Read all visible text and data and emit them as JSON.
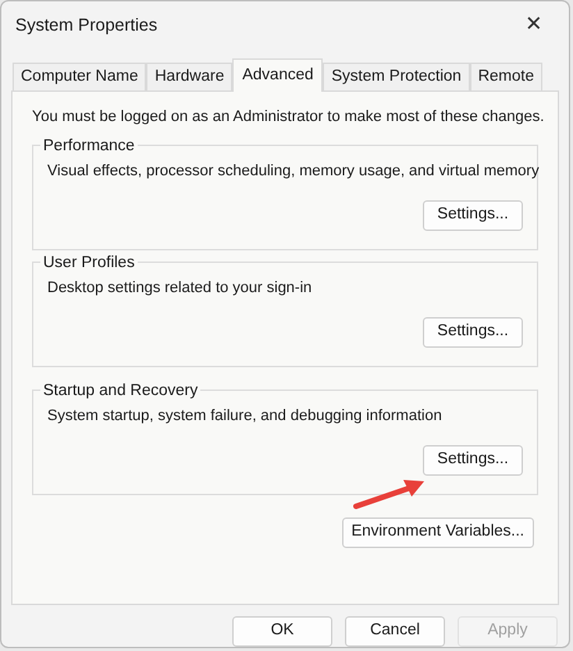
{
  "window": {
    "title": "System Properties",
    "close": "✕"
  },
  "tabs": [
    {
      "label": "Computer Name",
      "selected": false
    },
    {
      "label": "Hardware",
      "selected": false
    },
    {
      "label": "Advanced",
      "selected": true
    },
    {
      "label": "System Protection",
      "selected": false
    },
    {
      "label": "Remote",
      "selected": false
    }
  ],
  "notice": "You must be logged on as an Administrator to make most of these changes.",
  "groups": [
    {
      "title": "Performance",
      "description": "Visual effects, processor scheduling, memory usage, and virtual memory",
      "button": "Settings..."
    },
    {
      "title": "User Profiles",
      "description": "Desktop settings related to your sign-in",
      "button": "Settings..."
    },
    {
      "title": "Startup and Recovery",
      "description": "System startup, system failure, and debugging information",
      "button": "Settings..."
    }
  ],
  "environment_button": "Environment Variables...",
  "buttons": [
    {
      "label": "OK",
      "disabled": false
    },
    {
      "label": "Cancel",
      "disabled": false
    },
    {
      "label": "Apply",
      "disabled": true
    }
  ]
}
